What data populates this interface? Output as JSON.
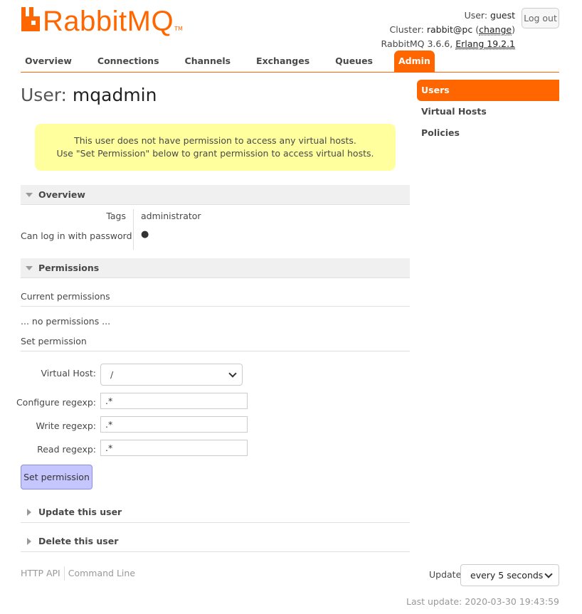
{
  "logo": {
    "text": "RabbitMQ",
    "tm": "TM"
  },
  "login": {
    "user_label": "User:",
    "user": "guest",
    "cluster_label": "Cluster:",
    "cluster": "rabbit@pc",
    "change": "change",
    "version_prefix": "RabbitMQ 3.6.6,",
    "erlang": "Erlang 19.2.1",
    "logout": "Log out"
  },
  "tabs": [
    "Overview",
    "Connections",
    "Channels",
    "Exchanges",
    "Queues",
    "Admin"
  ],
  "page": {
    "title_prefix": "User:",
    "title_name": "mqadmin"
  },
  "warning": {
    "line1": "This user does not have permission to access any virtual hosts.",
    "line2": "Use \"Set Permission\" below to grant permission to access virtual hosts."
  },
  "overview": {
    "heading": "Overview",
    "tags_label": "Tags",
    "tags_value": "administrator",
    "login_label": "Can log in with password",
    "login_value": "●"
  },
  "permissions": {
    "heading": "Permissions",
    "current": "Current permissions",
    "none": "... no permissions ...",
    "set": "Set permission",
    "vhost_label": "Virtual Host:",
    "vhost_value": "/",
    "configure_label": "Configure regexp:",
    "configure_value": ".*",
    "write_label": "Write regexp:",
    "write_value": ".*",
    "read_label": "Read regexp:",
    "read_value": ".*",
    "button": "Set permission"
  },
  "collapsed": {
    "update": "Update this user",
    "delete": "Delete this user"
  },
  "sidebar": [
    "Users",
    "Virtual Hosts",
    "Policies"
  ],
  "footer": {
    "http_api": "HTTP API",
    "cli": "Command Line",
    "update_label": "Update",
    "update_value": "every 5 seconds",
    "last_update": "Last update: 2020-03-30 19:43:59"
  },
  "colors": {
    "accent": "#ff6600",
    "warning_bg": "#ffff9e",
    "button_bg": "#c6c6ff"
  }
}
